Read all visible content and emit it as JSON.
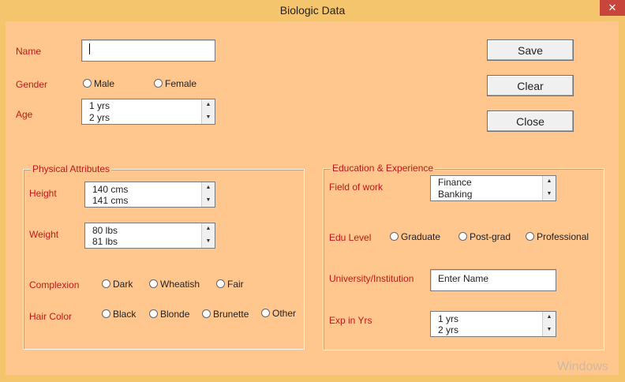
{
  "window": {
    "title": "Biologic Data",
    "close_label": "✕"
  },
  "form": {
    "name": {
      "label": "Name",
      "value": ""
    },
    "gender": {
      "label": "Gender",
      "options": [
        "Male",
        "Female"
      ]
    },
    "age": {
      "label": "Age",
      "items": [
        "1 yrs",
        "2 yrs"
      ]
    }
  },
  "buttons": {
    "save": "Save",
    "clear": "Clear",
    "close": "Close"
  },
  "physical": {
    "title": "Physical Attributes",
    "height": {
      "label": "Height",
      "items": [
        "140 cms",
        "141 cms"
      ]
    },
    "weight": {
      "label": "Weight",
      "items": [
        "80 lbs",
        "81 lbs"
      ]
    },
    "complexion": {
      "label": "Complexion",
      "options": [
        "Dark",
        "Wheatish",
        "Fair"
      ]
    },
    "hair_color": {
      "label": "Hair Color",
      "options": [
        "Black",
        "Blonde",
        "Brunette",
        "Other"
      ]
    }
  },
  "education": {
    "title": "Education & Experience",
    "field_of_work": {
      "label": "Field of work",
      "items": [
        "Finance",
        "Banking"
      ]
    },
    "edu_level": {
      "label": "Edu Level",
      "options": [
        "Graduate",
        "Post-grad",
        "Professional"
      ]
    },
    "university": {
      "label": "University/Institution",
      "value": "Enter Name"
    },
    "exp": {
      "label": "Exp in Yrs",
      "items": [
        "1 yrs",
        "2 yrs"
      ]
    }
  },
  "icons": {
    "scroll_up": "▲",
    "scroll_down": "▼"
  },
  "watermark": "Windows"
}
